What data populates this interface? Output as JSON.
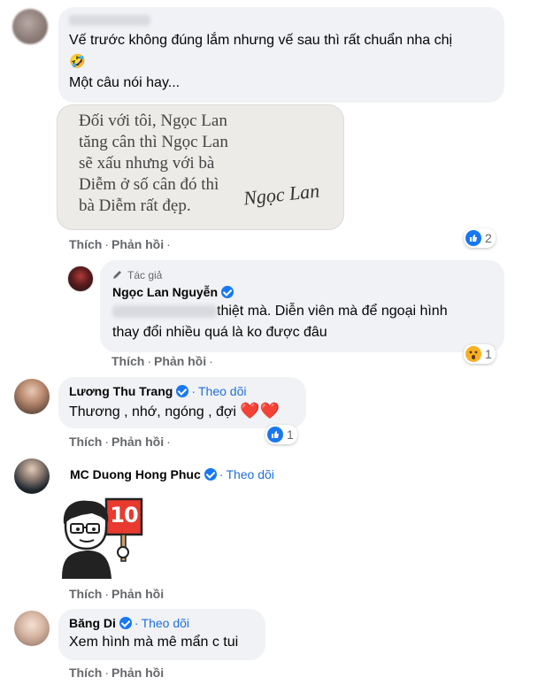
{
  "comments": {
    "c1": {
      "text_line1": "Vế trước không đúng lắm nhưng vế sau thì rất chuẩn nha chị",
      "emoji": "🤣",
      "text_line2": "Một câu nói hay...",
      "quote_image": {
        "lines": [
          "Đối với tôi, Ngọc Lan",
          "tăng cân thì Ngọc Lan",
          "sẽ xấu nhưng với bà",
          "Diễm ở số cân đó thì",
          "bà Diễm rất đẹp."
        ],
        "signature": "Ngọc Lan"
      },
      "like_label": "Thích",
      "reply_label": "Phản hồi",
      "reaction_count": "2"
    },
    "reply1": {
      "author_badge": "Tác giả",
      "author": "Ngọc Lan Nguyễn",
      "text_line1": "thiệt mà. Diễn viên mà để ngoại hình",
      "text_line2": "thay đổi nhiều quá là ko được đâu",
      "like_label": "Thích",
      "reply_label": "Phản hồi",
      "reaction_count": "1"
    },
    "c2": {
      "author": "Lương Thu Trang",
      "follow_label": "Theo dõi",
      "text": "Thương , nhớ, ngóng , đợi",
      "hearts": "❤️❤️",
      "like_label": "Thích",
      "reply_label": "Phản hồi",
      "reaction_count": "1"
    },
    "c3": {
      "author": "MC Duong Hong Phuc",
      "follow_label": "Theo dõi",
      "sticker_sign": "10",
      "like_label": "Thích",
      "reply_label": "Phản hồi"
    },
    "c4": {
      "author": "Băng Di",
      "follow_label": "Theo dõi",
      "text": "Xem hình mà mê mẩn c tui",
      "like_label": "Thích",
      "reply_label": "Phản hồi"
    }
  },
  "colors": {
    "bubble": "#f0f2f5",
    "link_blue": "#216fdb",
    "verified": "#1877f2",
    "action_gray": "#65676b"
  }
}
